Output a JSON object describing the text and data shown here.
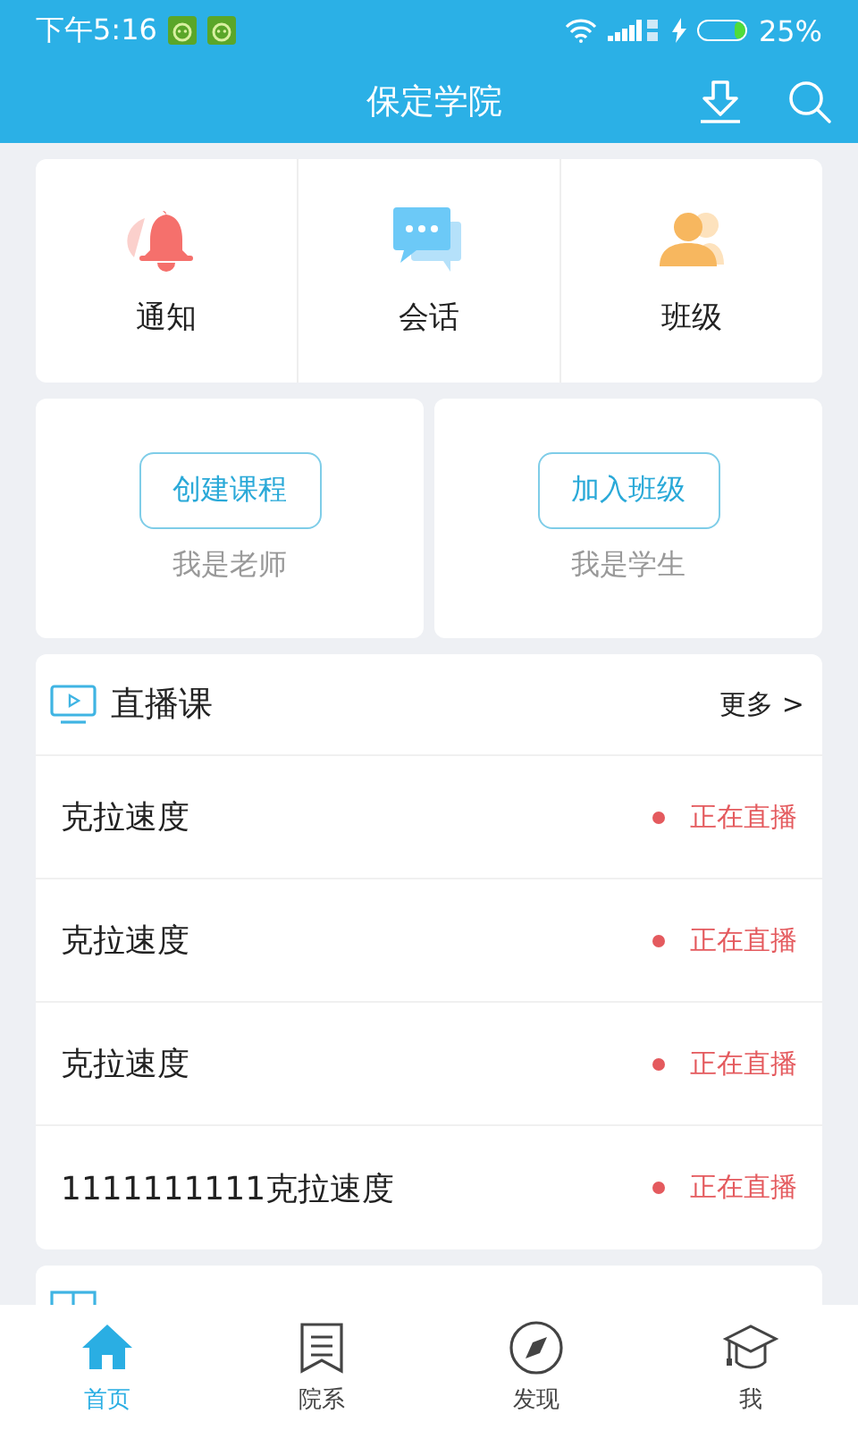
{
  "status_bar": {
    "time": "下午5:16",
    "battery": "25%"
  },
  "header": {
    "title": "保定学院"
  },
  "shortcuts": [
    {
      "kind": "bell",
      "label": "通知"
    },
    {
      "kind": "chat",
      "label": "会话"
    },
    {
      "kind": "people",
      "label": "班级"
    }
  ],
  "roles": [
    {
      "button": "创建课程",
      "caption": "我是老师"
    },
    {
      "button": "加入班级",
      "caption": "我是学生"
    }
  ],
  "live": {
    "title": "直播课",
    "more": "更多 >",
    "rows": [
      {
        "name": "克拉速度",
        "status": "正在直播"
      },
      {
        "name": "克拉速度",
        "status": "正在直播"
      },
      {
        "name": "克拉速度",
        "status": "正在直播"
      },
      {
        "name": "1111111111克拉速度",
        "status": "正在直播"
      }
    ]
  },
  "tabs": [
    {
      "kind": "home",
      "label": "首页",
      "selected": true
    },
    {
      "kind": "list",
      "label": "院系",
      "selected": false
    },
    {
      "kind": "compass",
      "label": "发现",
      "selected": false
    },
    {
      "kind": "cap",
      "label": "我",
      "selected": false
    }
  ]
}
